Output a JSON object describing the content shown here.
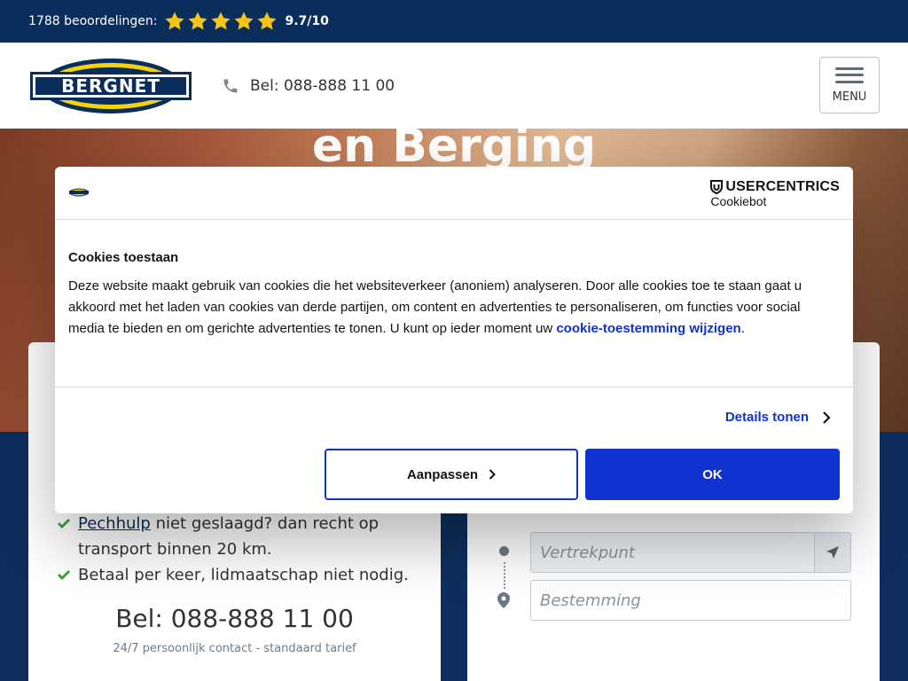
{
  "topbar": {
    "reviews": "1788 beoordelingen:",
    "score": "9.7/10",
    "star_count": 5,
    "star_color": "#f5c518"
  },
  "header": {
    "logo_text": "BERGNET",
    "phone": "Bel: 088-888 11 00",
    "menu_label": "MENU",
    "brand_colors": {
      "navy": "#0b2d5b",
      "yellow": "#f5d20a"
    }
  },
  "hero": {
    "title": "en Berging"
  },
  "left_panel": {
    "items": [
      {
        "link": "Pechhulp",
        "text_1": " niet geslaagd? dan recht op",
        "text_2": "transport binnen 20 km."
      },
      {
        "text": "Betaal per keer, lidmaatschap niet nodig."
      }
    ],
    "phone": "Bel: 088-888 11 00",
    "phone_sub": "24/7 persoonlijk contact - standaard tarief"
  },
  "right_panel": {
    "from_placeholder": "Vertrekpunt",
    "to_placeholder": "Bestemming"
  },
  "cookie_dialog": {
    "provider_name": "USERCENTRICS",
    "provider_sub": "Cookiebot",
    "title": "Cookies toestaan",
    "text": "Deze website maakt gebruik van cookies die het websiteverkeer (anoniem) analyseren. Door alle cookies toe te staan gaat u akkoord met het laden van cookies van derde partijen, om content en advertenties te personaliseren, om functies voor social media te bieden en om gerichte advertenties te tonen. U kunt op ieder moment uw ",
    "link": "cookie-toestemming wijzigen",
    "text_end": ".",
    "details": "Details tonen",
    "customize": "Aanpassen",
    "ok": "OK",
    "accent_color": "#1032cf"
  }
}
